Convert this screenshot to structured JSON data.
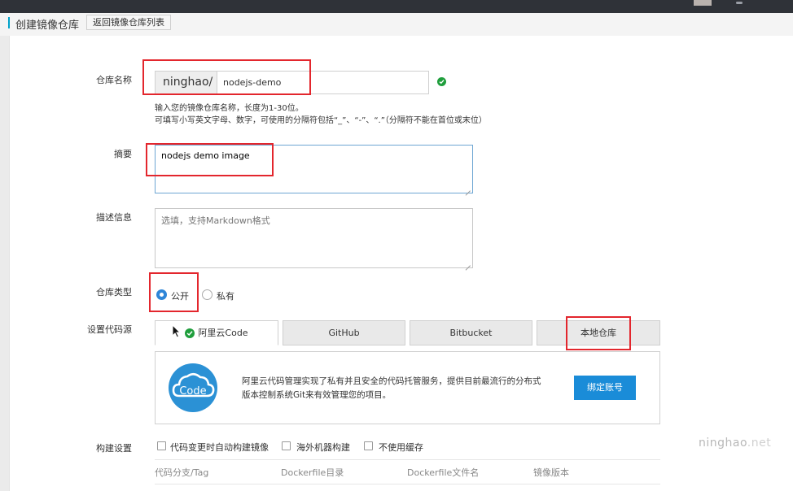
{
  "header": {
    "title": "创建镜像仓库",
    "back_label": "返回镜像仓库列表"
  },
  "form": {
    "repo_name": {
      "label": "仓库名称",
      "namespace": "ninghao/",
      "value": "nodejs-demo",
      "hint_line1": "输入您的镜像仓库名称，长度为1-30位。",
      "hint_line2": "可填写小写英文字母、数字，可使用的分隔符包括“_”、“-”、“.”（分隔符不能在首位或末位）"
    },
    "summary": {
      "label": "摘要",
      "value": "nodejs demo image"
    },
    "description": {
      "label": "描述信息",
      "placeholder": "选填，支持Markdown格式"
    },
    "repo_type": {
      "label": "仓库类型",
      "options": [
        "公开",
        "私有"
      ],
      "selected": "公开"
    },
    "code_source": {
      "label": "设置代码源",
      "tabs": [
        "阿里云Code",
        "GitHub",
        "Bitbucket",
        "本地仓库"
      ],
      "active": "阿里云Code",
      "description": "阿里云代码管理实现了私有并且安全的代码托管服务，提供目前最流行的分布式版本控制系统Git来有效管理您的项目。",
      "logo_text": "Code",
      "bind_label": "绑定账号"
    },
    "build": {
      "label": "构建设置",
      "options": [
        "代码变更时自动构建镜像",
        "海外机器构建",
        "不使用缓存"
      ],
      "columns": [
        "代码分支/Tag",
        "Dockerfile目录",
        "Dockerfile文件名",
        "镜像版本"
      ]
    }
  },
  "watermark": {
    "brand": "ninghao",
    "suffix": ".net"
  },
  "colors": {
    "accent": "#1a8cd8",
    "success": "#1f9e3c",
    "highlight": "#e3262d",
    "topbar": "#2f3238"
  }
}
